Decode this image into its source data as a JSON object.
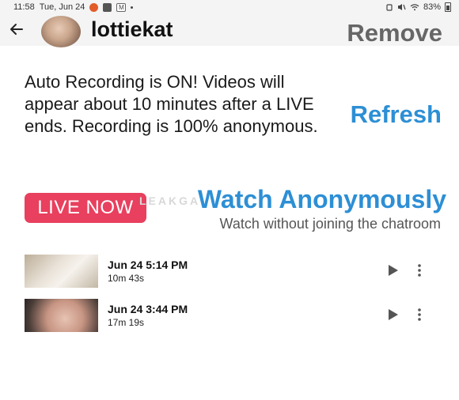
{
  "status_bar": {
    "time": "11:58",
    "date": "Tue, Jun 24",
    "battery": "83%"
  },
  "header": {
    "username": "lottiekat",
    "remove_label": "Remove"
  },
  "notice": {
    "text": "Auto Recording is ON! Videos will appear about 10 minutes after a LIVE ends. Recording is 100% anonymous."
  },
  "refresh_label": "Refresh",
  "live": {
    "live_now_label": "LIVE NOW",
    "watch_anon_label": "Watch Anonymously",
    "watch_anon_sub": "Watch without joining the chatroom",
    "watermark": "LEAKGA"
  },
  "recordings": [
    {
      "date": "Jun 24 5:14 PM",
      "duration": "10m 43s"
    },
    {
      "date": "Jun 24 3:44 PM",
      "duration": "17m 19s"
    }
  ],
  "colors": {
    "accent_blue": "#2d8fd5",
    "live_red": "#e8405e"
  }
}
